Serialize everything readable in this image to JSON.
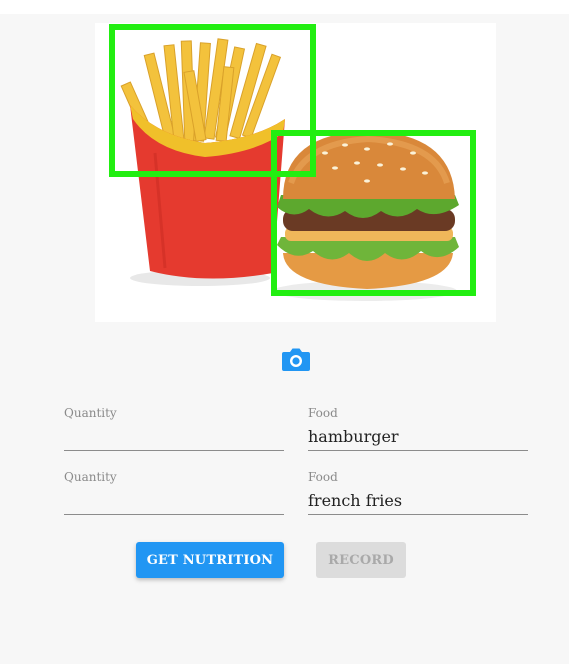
{
  "detection": {
    "boxes": [
      {
        "label": "french fries",
        "color": "#22ee11"
      },
      {
        "label": "hamburger",
        "color": "#22ee11"
      }
    ]
  },
  "camera": {
    "icon": "camera-icon",
    "color": "#2196f3"
  },
  "rows": [
    {
      "quantity_label": "Quantity",
      "quantity_value": "",
      "food_label": "Food",
      "food_value": "hamburger"
    },
    {
      "quantity_label": "Quantity",
      "quantity_value": "",
      "food_label": "Food",
      "food_value": "french fries"
    }
  ],
  "buttons": {
    "get_nutrition": "GET NUTRITION",
    "record": "RECORD"
  },
  "colors": {
    "primary": "#2196f3",
    "disabled_bg": "#dcdcdc",
    "disabled_text": "#a9a9a9"
  }
}
